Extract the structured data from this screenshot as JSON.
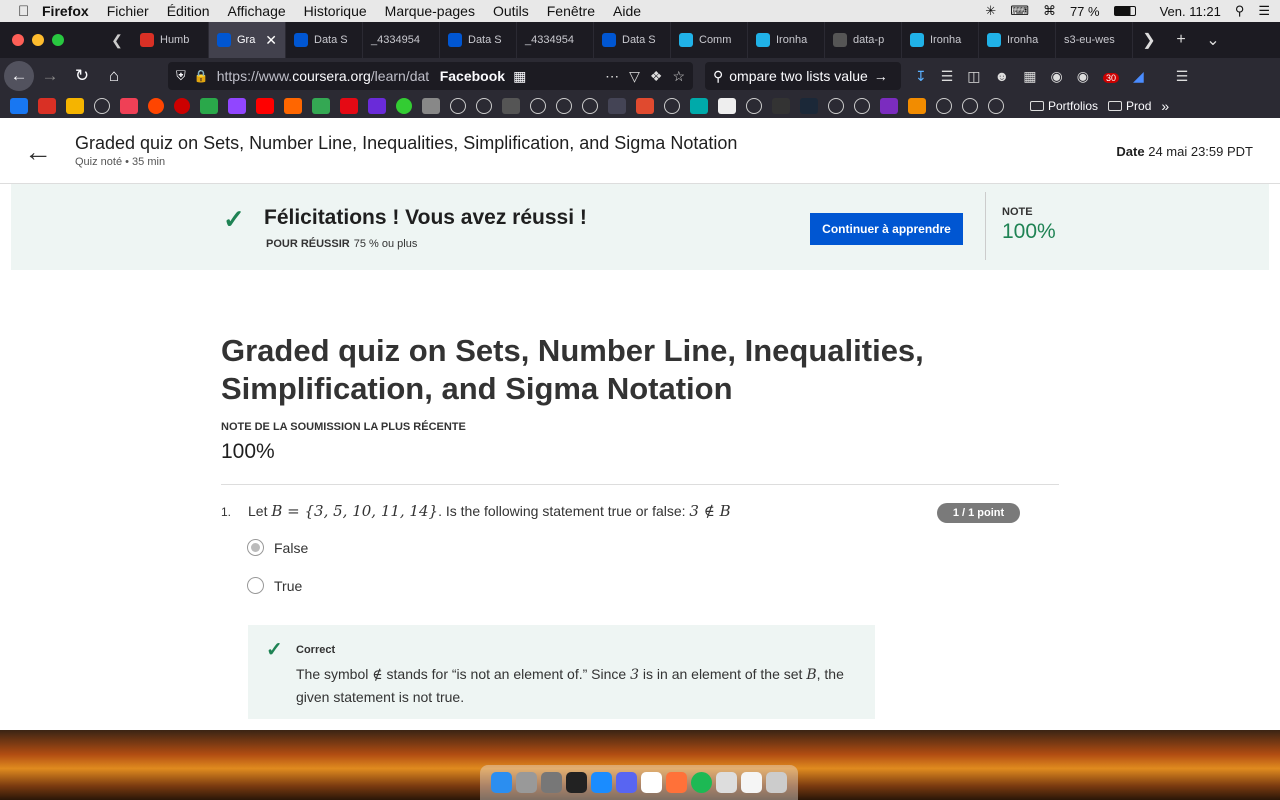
{
  "menubar": {
    "app": "Firefox",
    "items": [
      "Fichier",
      "Édition",
      "Affichage",
      "Historique",
      "Marque-pages",
      "Outils",
      "Fenêtre",
      "Aide"
    ],
    "battery": "77 %",
    "clock": "Ven. 11:21"
  },
  "tabs": [
    {
      "label": "Humb",
      "icon": "gmail-icon",
      "color": "#d93025"
    },
    {
      "label": "Gra",
      "icon": "coursera-icon",
      "color": "#0056d2",
      "active": true
    },
    {
      "label": "Data S",
      "icon": "coursera-icon",
      "color": "#0056d2"
    },
    {
      "label": "_4334954",
      "icon": "",
      "color": ""
    },
    {
      "label": "Data S",
      "icon": "coursera-icon",
      "color": "#0056d2"
    },
    {
      "label": "_4334954",
      "icon": "",
      "color": ""
    },
    {
      "label": "Data S",
      "icon": "coursera-icon",
      "color": "#0056d2"
    },
    {
      "label": "Comm",
      "icon": "hex-icon",
      "color": "#20b2e8"
    },
    {
      "label": "Ironha",
      "icon": "ironhack-icon",
      "color": "#20b2e8"
    },
    {
      "label": "data-p",
      "icon": "github-icon",
      "color": "#555"
    },
    {
      "label": "Ironha",
      "icon": "ironhack-icon",
      "color": "#20b2e8"
    },
    {
      "label": "Ironha",
      "icon": "ironhack-icon",
      "color": "#20b2e8"
    },
    {
      "label": "s3-eu-wes",
      "icon": "",
      "color": ""
    }
  ],
  "navbar": {
    "url_prefix": "https://www.",
    "url_domain": "coursera.org",
    "url_rest": "/learn/dat",
    "bookmark_label": "Facebook",
    "search_text": "ompare two lists value",
    "notifications_badge": "30"
  },
  "bookmarks": {
    "folders": [
      "Portfolios",
      "Prod"
    ]
  },
  "header": {
    "title": "Graded quiz on Sets, Number Line, Inequalities, Simplification, and Sigma Notation",
    "subtitle": "Quiz noté • 35  min",
    "date_label": "Date",
    "date_value": "24 mai 23:59 PDT"
  },
  "banner": {
    "congrats": "Félicitations ! Vous avez réussi !",
    "pass_label": "POUR RÉUSSIR",
    "pass_value": "75 % ou plus",
    "continue_button": "Continuer à apprendre",
    "note_label": "NOTE",
    "note_value": "100%",
    "accent_color": "#1f8354"
  },
  "quiz": {
    "title": "Graded quiz on Sets, Number Line, Inequalities, Simplification, and Sigma Notation",
    "recent_label": "NOTE DE LA SOUMISSION LA PLUS RÉCENTE",
    "recent_value": "100%",
    "question": {
      "number": "1.",
      "prefix": "Let ",
      "math1": "B = {3, 5, 10, 11, 14}",
      "middle": ". Is the following statement true or false: ",
      "math2": "3 ∉ B",
      "points": "1 / 1 point",
      "options": [
        {
          "label": "False",
          "selected": true
        },
        {
          "label": "True",
          "selected": false
        }
      ],
      "feedback": {
        "label": "Correct",
        "t1": "The symbol ",
        "m1": "∉",
        "t2": " stands for “is not an element of.” Since ",
        "m2": "3",
        "t3": " is in an element of the set ",
        "m3": "B",
        "t4": ", the given statement is not true."
      }
    }
  }
}
